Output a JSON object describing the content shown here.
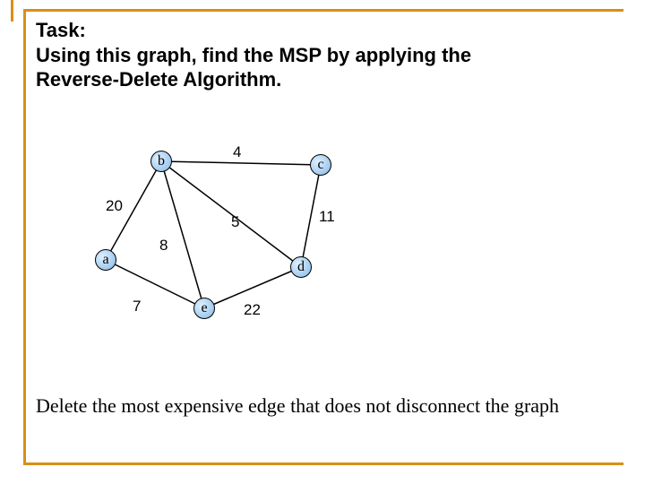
{
  "task": {
    "heading": "Task:",
    "line1": "Using this graph, find the MSP by applying the",
    "line2": "Reverse-Delete Algorithm."
  },
  "graph": {
    "nodes": {
      "a": "a",
      "b": "b",
      "c": "c",
      "d": "d",
      "e": "e"
    },
    "edge_weights": {
      "ab": "20",
      "bc": "4",
      "cd": "11",
      "bd": "5",
      "be": "8",
      "ae": "7",
      "ed": "22"
    }
  },
  "instruction": "Delete the most expensive edge that does not disconnect the graph",
  "chart_data": {
    "type": "table",
    "title": "Weighted undirected graph for Reverse-Delete MSP",
    "nodes": [
      "a",
      "b",
      "c",
      "d",
      "e"
    ],
    "edges": [
      {
        "u": "a",
        "v": "b",
        "w": 20
      },
      {
        "u": "b",
        "v": "c",
        "w": 4
      },
      {
        "u": "c",
        "v": "d",
        "w": 11
      },
      {
        "u": "b",
        "v": "d",
        "w": 5
      },
      {
        "u": "b",
        "v": "e",
        "w": 8
      },
      {
        "u": "a",
        "v": "e",
        "w": 7
      },
      {
        "u": "e",
        "v": "d",
        "w": 22
      }
    ]
  }
}
